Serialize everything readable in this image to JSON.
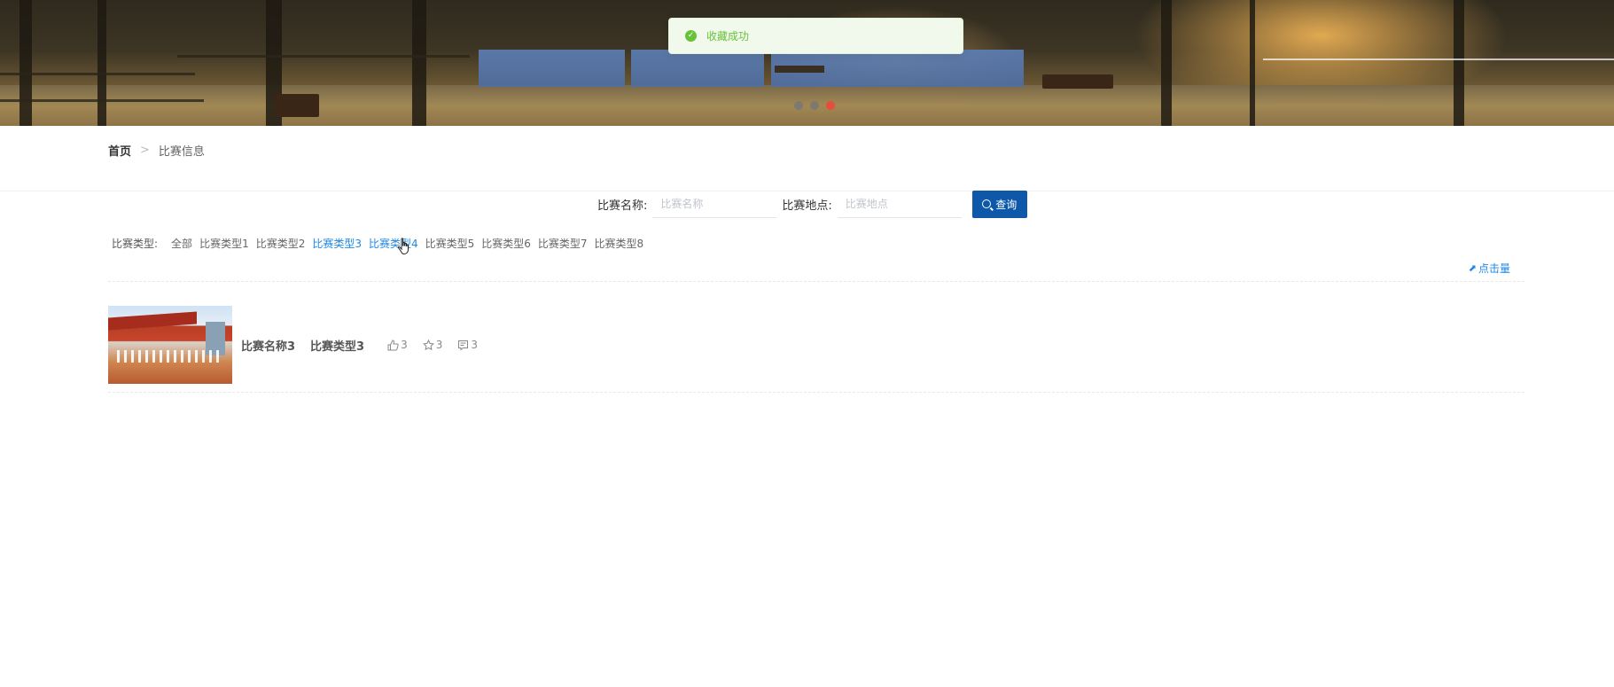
{
  "toast": {
    "message": "收藏成功"
  },
  "carousel": {
    "slide_count": 3,
    "active_index": 2
  },
  "breadcrumb": {
    "home": "首页",
    "separator": ">",
    "current": "比赛信息"
  },
  "search": {
    "name_label": "比赛名称:",
    "name_placeholder": "比赛名称",
    "place_label": "比赛地点:",
    "place_placeholder": "比赛地点",
    "button_label": "查询"
  },
  "type_filter": {
    "label": "比赛类型:",
    "items": [
      "全部",
      "比赛类型1",
      "比赛类型2",
      "比赛类型3",
      "比赛类型4",
      "比赛类型5",
      "比赛类型6",
      "比赛类型7",
      "比赛类型8"
    ],
    "highlighted": [
      "比赛类型3",
      "比赛类型4"
    ]
  },
  "sort": {
    "label": "点击量"
  },
  "items": [
    {
      "title": "比赛名称3",
      "type": "比赛类型3",
      "likes": "3",
      "favorites": "3",
      "comments": "3"
    }
  ],
  "colors": {
    "primary": "#0d58a9",
    "link": "#1e88e5",
    "success": "#67c23a",
    "active_dot": "#e84c3d"
  }
}
